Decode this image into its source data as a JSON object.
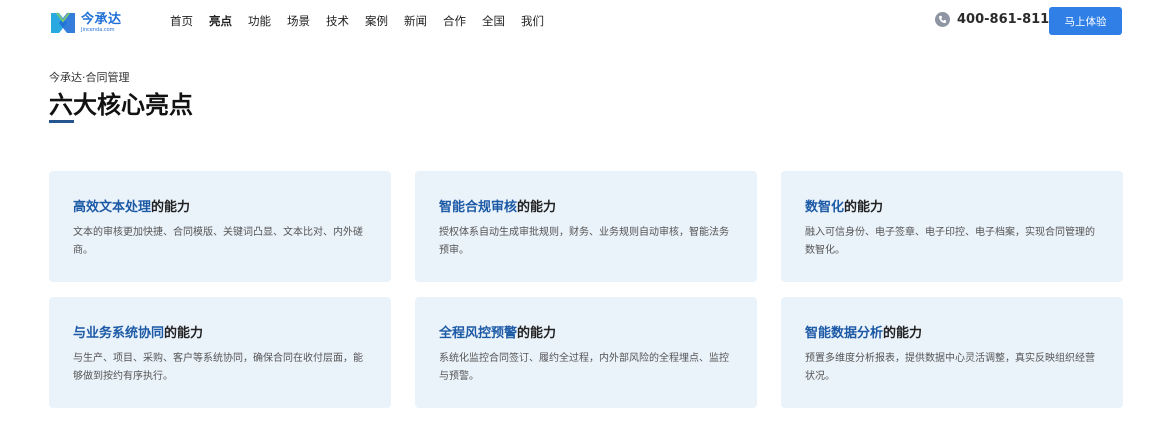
{
  "brand": {
    "name": "今承达",
    "sub": "Jincenda.com",
    "colors": {
      "primary": "#1f6fd6",
      "cta": "#2f7fe6",
      "accent": "#1c5aa6",
      "card_bg": "#eaf2fa"
    }
  },
  "nav": {
    "items": [
      {
        "label": "首页"
      },
      {
        "label": "亮点",
        "active": true
      },
      {
        "label": "功能"
      },
      {
        "label": "场景"
      },
      {
        "label": "技术"
      },
      {
        "label": "案例"
      },
      {
        "label": "新闻"
      },
      {
        "label": "合作"
      },
      {
        "label": "全国"
      },
      {
        "label": "我们"
      }
    ]
  },
  "contact": {
    "icon": "phone-icon",
    "phone": "400-861-8118"
  },
  "cta": {
    "label": "马上体验"
  },
  "section": {
    "kicker": "今承达·合同管理",
    "title": "六大核心亮点"
  },
  "cards": [
    {
      "highlight": "高效文本处理",
      "suffix": "的能力",
      "desc": "文本的审核更加快捷、合同模版、关键词凸显、文本比对、内外磋商。"
    },
    {
      "highlight": "智能合规审核",
      "suffix": "的能力",
      "desc": "授权体系自动生成审批规则，财务、业务规则自动审核，智能法务预审。"
    },
    {
      "highlight": "数智化",
      "suffix": "的能力",
      "desc": "融入可信身份、电子签章、电子印控、电子档案，实现合同管理的数智化。"
    },
    {
      "highlight": "与业务系统协同",
      "suffix": "的能力",
      "desc": "与生产、项目、采购、客户等系统协同，确保合同在收付层面，能够做到按约有序执行。"
    },
    {
      "highlight": "全程风控预警",
      "suffix": "的能力",
      "desc": "系统化监控合同签订、履约全过程，内外部风险的全程埋点、监控与预警。"
    },
    {
      "highlight": "智能数据分析",
      "suffix": "的能力",
      "desc": "预置多维度分析报表，提供数据中心灵活调整，真实反映组织经营状况。"
    }
  ]
}
